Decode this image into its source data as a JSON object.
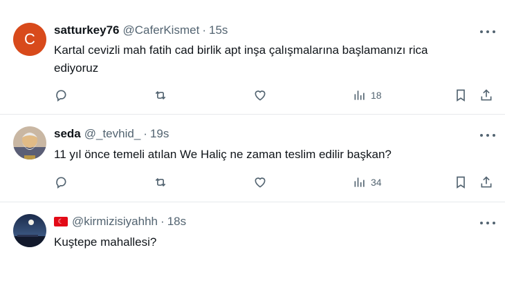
{
  "tweets": [
    {
      "avatar_letter": "C",
      "avatar_color": "#d84a1b",
      "name": "satturkey76",
      "handle": "@CaferKismet",
      "separator": "·",
      "time": "15s",
      "text": "Kartal cevizli mah fatih cad birlik apt inşa çalışmalarına başlamanızı rica ediyoruz",
      "views": "18"
    },
    {
      "name": "seda",
      "handle": "@_tevhid_",
      "separator": "·",
      "time": "19s",
      "text": "11 yıl önce temeli atılan We Haliç ne zaman teslim edilir başkan?",
      "views": "34"
    },
    {
      "handle": "@kirmizisiyahhh",
      "separator": "·",
      "time": "18s",
      "flag_icon": "turkey-flag-icon",
      "text": "Kuştepe mahallesi?"
    }
  ],
  "icons": {
    "reply": "reply-icon",
    "retweet": "retweet-icon",
    "like": "like-icon",
    "views": "views-icon",
    "bookmark": "bookmark-icon",
    "share": "share-icon",
    "more": "more-icon"
  },
  "colors": {
    "text": "#0f1419",
    "secondary": "#536471",
    "divider": "#e6e9ec"
  }
}
